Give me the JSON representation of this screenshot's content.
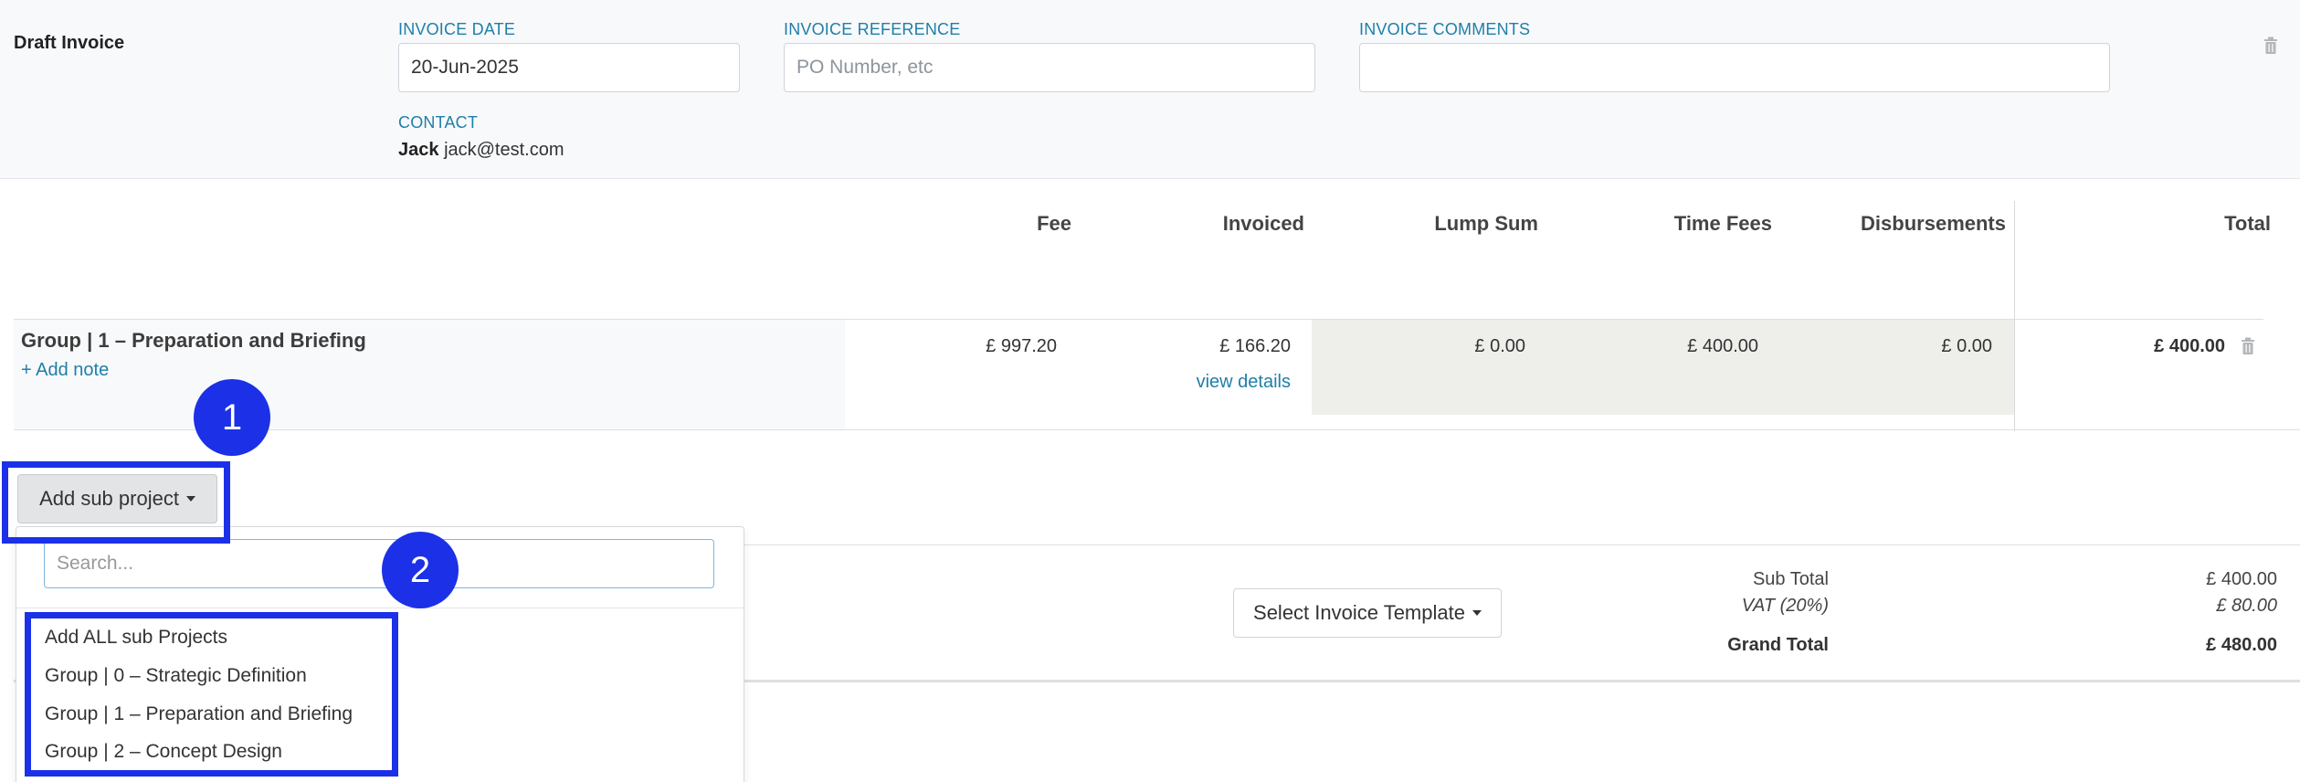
{
  "header": {
    "title": "Draft Invoice",
    "invoice_date_label": "INVOICE DATE",
    "invoice_date_value": "20-Jun-2025",
    "invoice_reference_label": "INVOICE REFERENCE",
    "invoice_reference_placeholder": "PO Number, etc",
    "invoice_comments_label": "INVOICE COMMENTS",
    "invoice_comments_value": "",
    "contact_label": "CONTACT",
    "contact_name": "Jack",
    "contact_email": "jack@test.com"
  },
  "table": {
    "columns": [
      "Fee",
      "Invoiced",
      "Lump Sum",
      "Time Fees",
      "Disbursements",
      "Total"
    ],
    "row": {
      "title": "Group | 1 – Preparation and Briefing",
      "add_note": "+ Add note",
      "fee": "£ 997.20",
      "invoiced": "£ 166.20",
      "view_details": "view details",
      "lump_sum": "£ 0.00",
      "time_fees": "£ 400.00",
      "disbursements": "£ 0.00",
      "total": "£ 400.00"
    }
  },
  "add_sub_project": {
    "button_label": "Add sub project",
    "search_placeholder": "Search...",
    "items": [
      "Add ALL sub Projects",
      "Group | 0 – Strategic Definition",
      "Group | 1 – Preparation and Briefing",
      "Group | 2 – Concept Design"
    ]
  },
  "template_button_label": "Select Invoice Template",
  "totals": {
    "sub_total_label": "Sub Total",
    "sub_total_value": "£ 400.00",
    "vat_label": "VAT (20%)",
    "vat_value": "£ 80.00",
    "grand_total_label": "Grand Total",
    "grand_total_value": "£ 480.00"
  },
  "annotations": {
    "badge_1": "1",
    "badge_2": "2",
    "highlight_color": "#1c30e8"
  },
  "colors": {
    "link": "#1f7fa8",
    "label": "#1f7fa8",
    "header_bg": "#f8f9fb",
    "shaded_cells": "#eeefeb"
  },
  "icons": [
    "trash-icon",
    "caret-down-icon"
  ]
}
